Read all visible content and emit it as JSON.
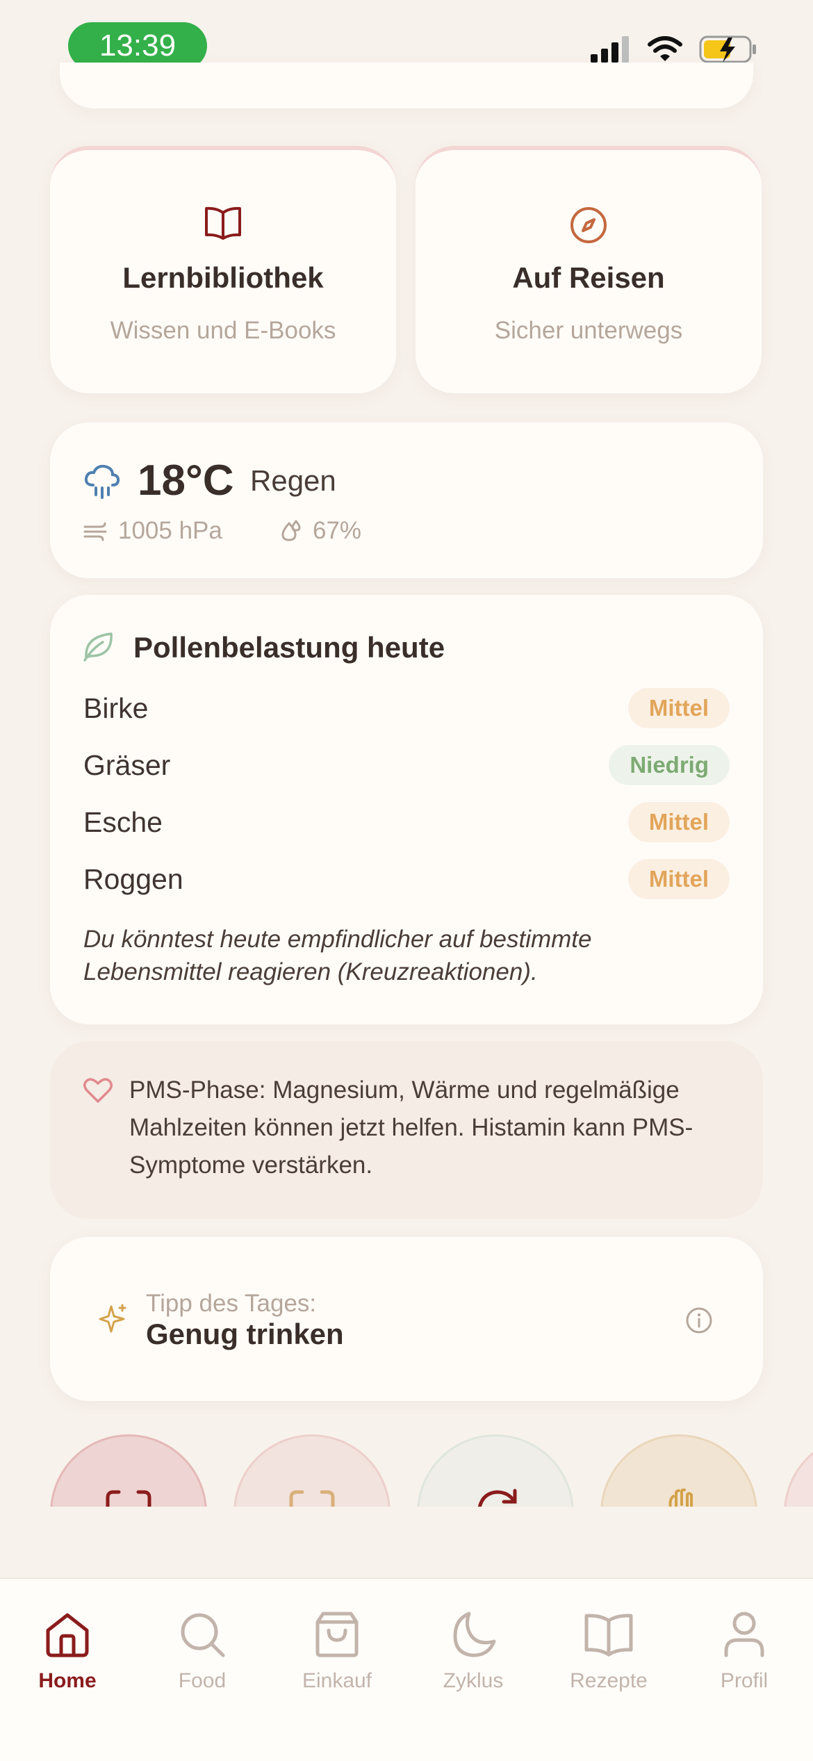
{
  "status_bar": {
    "time": "13:39"
  },
  "tiles": [
    {
      "title": "Lernbibliothek",
      "subtitle": "Wissen und E-Books",
      "icon": "book-icon"
    },
    {
      "title": "Auf Reisen",
      "subtitle": "Sicher unterwegs",
      "icon": "compass-icon"
    }
  ],
  "weather": {
    "temperature": "18°C",
    "condition": "Regen",
    "pressure": "1005 hPa",
    "humidity": "67%"
  },
  "pollen": {
    "title": "Pollenbelastung heute",
    "items": [
      {
        "name": "Birke",
        "level": "Mittel"
      },
      {
        "name": "Gräser",
        "level": "Niedrig"
      },
      {
        "name": "Esche",
        "level": "Mittel"
      },
      {
        "name": "Roggen",
        "level": "Mittel"
      }
    ],
    "note": "Du könntest heute empfindlicher auf bestimmte Lebensmittel reagieren (Kreuzreaktionen)."
  },
  "pms": {
    "text": "PMS-Phase: Magnesium, Wärme und regelmäßige Mahlzeiten können jetzt helfen. Histamin kann PMS-Symptome verstärken."
  },
  "tip": {
    "label": "Tipp des Tages:",
    "value": "Genug trinken"
  },
  "nav": {
    "items": [
      {
        "label": "Home",
        "icon": "home-icon",
        "active": true
      },
      {
        "label": "Food",
        "icon": "search-icon",
        "active": false
      },
      {
        "label": "Einkauf",
        "icon": "shopping-bag-icon",
        "active": false
      },
      {
        "label": "Zyklus",
        "icon": "moon-icon",
        "active": false
      },
      {
        "label": "Rezepte",
        "icon": "book-icon",
        "active": false
      },
      {
        "label": "Profil",
        "icon": "user-icon",
        "active": false
      }
    ]
  },
  "colors": {
    "accent": "#8a1c1c",
    "badge_medium": "#e2a55a",
    "badge_low": "#7daa74",
    "time_pill": "#33b04a"
  }
}
